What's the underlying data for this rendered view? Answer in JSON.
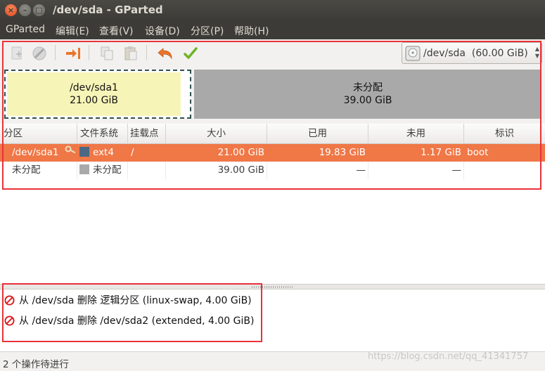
{
  "window": {
    "title": "/dev/sda - GParted",
    "close_glyph": "×",
    "min_glyph": "–",
    "max_glyph": "□"
  },
  "menu": [
    {
      "label": "GParted"
    },
    {
      "label": "编辑(E)"
    },
    {
      "label": "查看(V)"
    },
    {
      "label": "设备(D)"
    },
    {
      "label": "分区(P)"
    },
    {
      "label": "帮助(H)"
    }
  ],
  "toolbar": {
    "icons": [
      "new-partition-icon",
      "delete-icon",
      "resize-move-icon",
      "copy-icon",
      "paste-icon",
      "undo-icon",
      "apply-icon"
    ],
    "device_select": {
      "value": "/dev/sda  (60.00 GiB)"
    }
  },
  "partition_map": {
    "used": {
      "name": "/dev/sda1",
      "size": "21.00 GiB"
    },
    "free": {
      "name": "未分配",
      "size": "39.00 GiB"
    }
  },
  "table": {
    "columns": [
      "分区",
      "文件系统",
      "挂载点",
      "大小",
      "已用",
      "未用",
      "标识"
    ],
    "rows": [
      {
        "partition": "/dev/sda1",
        "fs": "ext4",
        "fs_color": "#4b6983",
        "mount": "/",
        "size": "21.00 GiB",
        "used": "19.83 GiB",
        "unused": "1.17 GiB",
        "flags": "boot",
        "locked": true
      },
      {
        "partition": "未分配",
        "fs": "未分配",
        "fs_color": "#a9a9a9",
        "mount": "",
        "size": "39.00 GiB",
        "used": "—",
        "unused": "—",
        "flags": ""
      }
    ]
  },
  "operations": [
    {
      "text": "从 /dev/sda 删除 逻辑分区 (linux-swap, 4.00 GiB)"
    },
    {
      "text": "从 /dev/sda 删除 /dev/sda2 (extended, 4.00 GiB)"
    }
  ],
  "status": {
    "text": "2 个操作待进行"
  },
  "watermark": "https://blog.csdn.net/qq_41341757",
  "colors": {
    "selection": "#f07746",
    "used_partition": "#f7f4b8",
    "unallocated": "#a9a9a9",
    "highlight": "#e8323a"
  }
}
